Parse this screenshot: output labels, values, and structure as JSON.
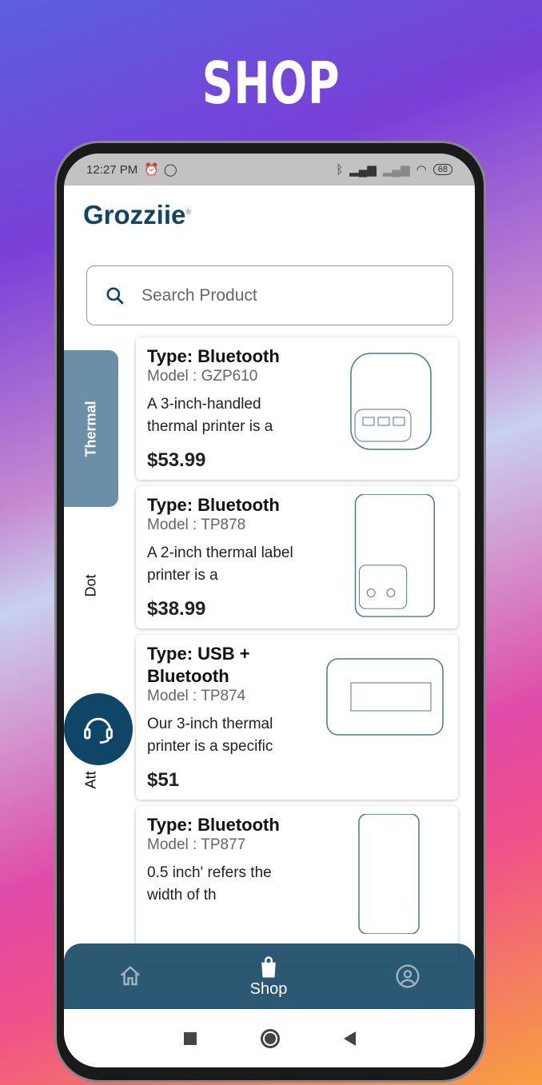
{
  "page_title": "SHOP",
  "status": {
    "time": "12:27 PM",
    "battery": "68"
  },
  "app": {
    "logo": "Grozziie",
    "logo_mark": "®"
  },
  "search": {
    "placeholder": "Search Product",
    "value": ""
  },
  "categories": [
    {
      "label": "Thermal",
      "active": true
    },
    {
      "label": "Dot",
      "active": false
    },
    {
      "label": "Att",
      "active": false
    }
  ],
  "products": [
    {
      "type": "Type: Bluetooth",
      "model": "Model : GZP610",
      "desc": "A 3-inch-handled thermal printer is a",
      "price": "$53.99"
    },
    {
      "type": "Type: Bluetooth",
      "model": "Model : TP878",
      "desc": "A 2-inch thermal label printer is a",
      "price": "$38.99"
    },
    {
      "type": "Type: USB + Bluetooth",
      "model": "Model : TP874",
      "desc": "Our 3-inch thermal printer is a specific",
      "price": "$51"
    },
    {
      "type": "Type: Bluetooth",
      "model": "Model : TP877",
      "desc": "0.5 inch' refers the width of th",
      "price": ""
    }
  ],
  "nav": {
    "home": "Home",
    "shop": "Shop",
    "profile": "Profile",
    "active": "Shop"
  },
  "colors": {
    "brand": "#0f4566",
    "tab_active": "#6c8fa8"
  }
}
